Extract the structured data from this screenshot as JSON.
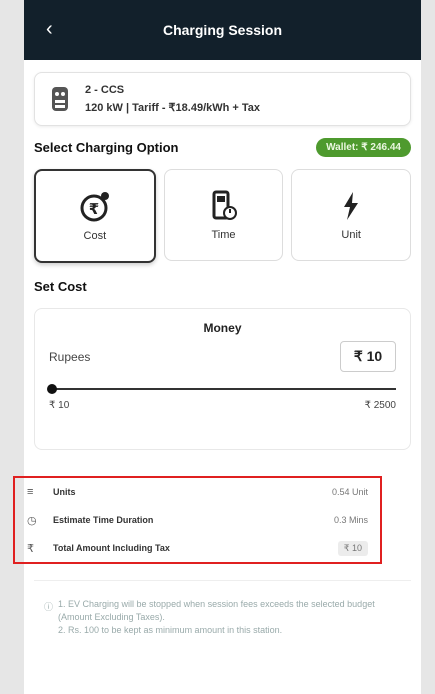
{
  "header": {
    "back_icon": "back-arrow-icon",
    "title": "Charging Session"
  },
  "connector": {
    "icon": "ccs-connector-icon",
    "line1": "2 - CCS",
    "line2": "120 kW | Tariff - ₹18.49/kWh + Tax"
  },
  "select": {
    "title": "Select Charging Option",
    "wallet": "Wallet: ₹ 246.44"
  },
  "options": [
    {
      "label": "Cost",
      "icon": "rupee-cost-icon"
    },
    {
      "label": "Time",
      "icon": "time-meter-icon"
    },
    {
      "label": "Unit",
      "icon": "lightning-icon"
    }
  ],
  "set_cost": {
    "title": "Set Cost",
    "money_title": "Money",
    "rupees_label": "Rupees",
    "amount": "₹ 10",
    "min_label": "₹ 10",
    "max_label": "₹ 2500",
    "slider_fraction": 0
  },
  "summary": [
    {
      "icon": "units-icon",
      "label": "Units",
      "value": "0.54 Unit"
    },
    {
      "icon": "clock-icon",
      "label": "Estimate Time Duration",
      "value": "0.3 Mins"
    },
    {
      "icon": "rupee-icon",
      "label": "Total Amount Including Tax",
      "value": "₹ 10"
    }
  ],
  "note": {
    "line1": "1. EV Charging will be stopped when session fees exceeds the selected budget (Amount Excluding Taxes).",
    "line2": "2. Rs. 100 to be kept as minimum amount in this station."
  }
}
